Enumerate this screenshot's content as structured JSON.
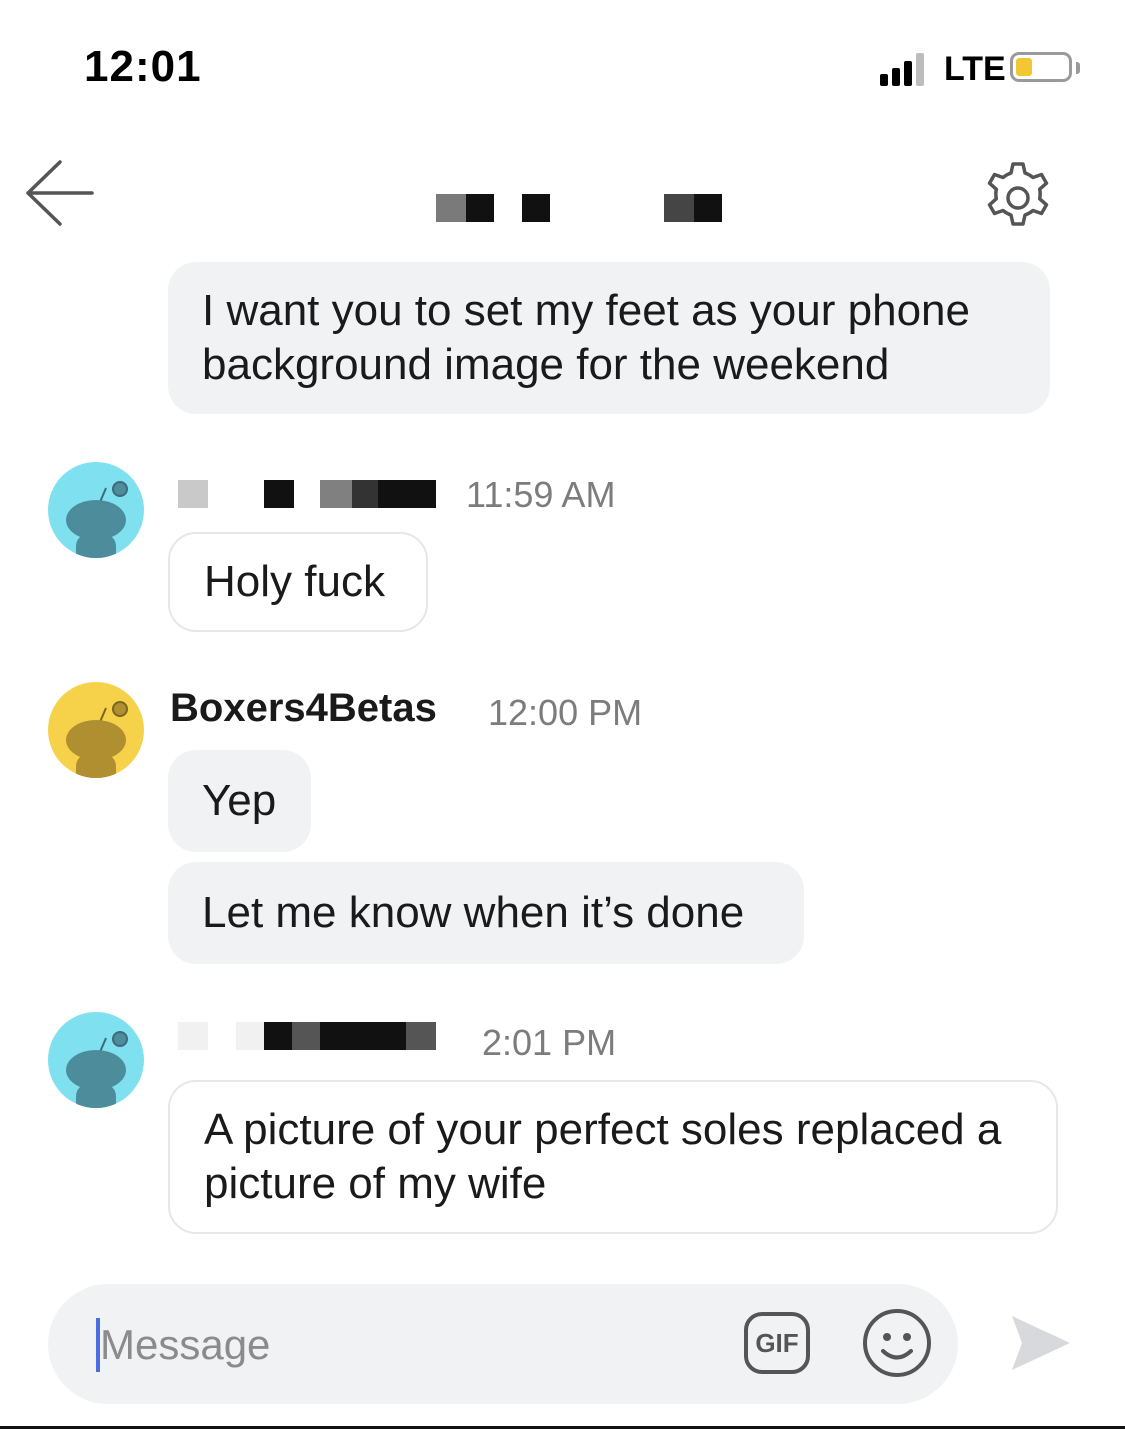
{
  "status_bar": {
    "time": "12:01",
    "network": "LTE",
    "battery_color": "#f3c634"
  },
  "header": {
    "back_icon": "arrow-left-icon",
    "settings_icon": "gear-icon"
  },
  "messages": [
    {
      "text": "I want you to set my feet as your phone background image for the weekend"
    },
    {
      "timestamp": "11:59 AM",
      "text": "Holy fuck",
      "avatar_color": "#7fe0ef"
    },
    {
      "username": "Boxers4Betas",
      "timestamp": "12:00 PM",
      "text": "Yep",
      "avatar_color": "#f5d24a"
    },
    {
      "text": "Let me know when it’s done"
    },
    {
      "timestamp": "2:01 PM",
      "text": "A picture of your perfect soles replaced a picture of my wife",
      "avatar_color": "#7fe0ef"
    }
  ],
  "composer": {
    "placeholder": "Message",
    "gif_label": "GIF",
    "emoji_icon": "smiley-icon",
    "send_icon": "send-arrow-icon"
  },
  "colors": {
    "own_bubble": "#f1f2f4",
    "other_bubble_border": "#e6e7ea",
    "cursor": "#4a6ee0"
  }
}
